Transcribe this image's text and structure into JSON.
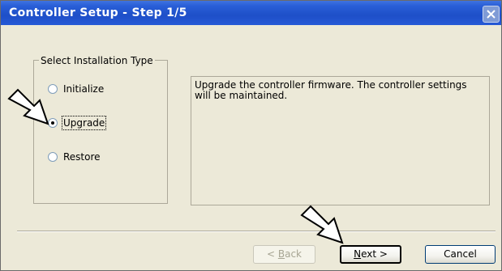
{
  "window": {
    "title": "Controller Setup - Step 1/5",
    "close_icon": "close-icon"
  },
  "install_type": {
    "legend": "Select Installation Type",
    "options": [
      {
        "label": "Initialize",
        "selected": false
      },
      {
        "label": "Upgrade",
        "selected": true
      },
      {
        "label": "Restore",
        "selected": false
      }
    ]
  },
  "description": "Upgrade the controller firmware. The controller settings will be maintained.",
  "buttons": {
    "back": {
      "label": "< Back",
      "mnemonic": "B",
      "enabled": false
    },
    "next": {
      "label": "Next >",
      "mnemonic": "N",
      "enabled": true
    },
    "cancel": {
      "label": "Cancel",
      "enabled": true
    }
  },
  "annotations": {
    "arrow_icon": "pointer-arrow-icon"
  }
}
